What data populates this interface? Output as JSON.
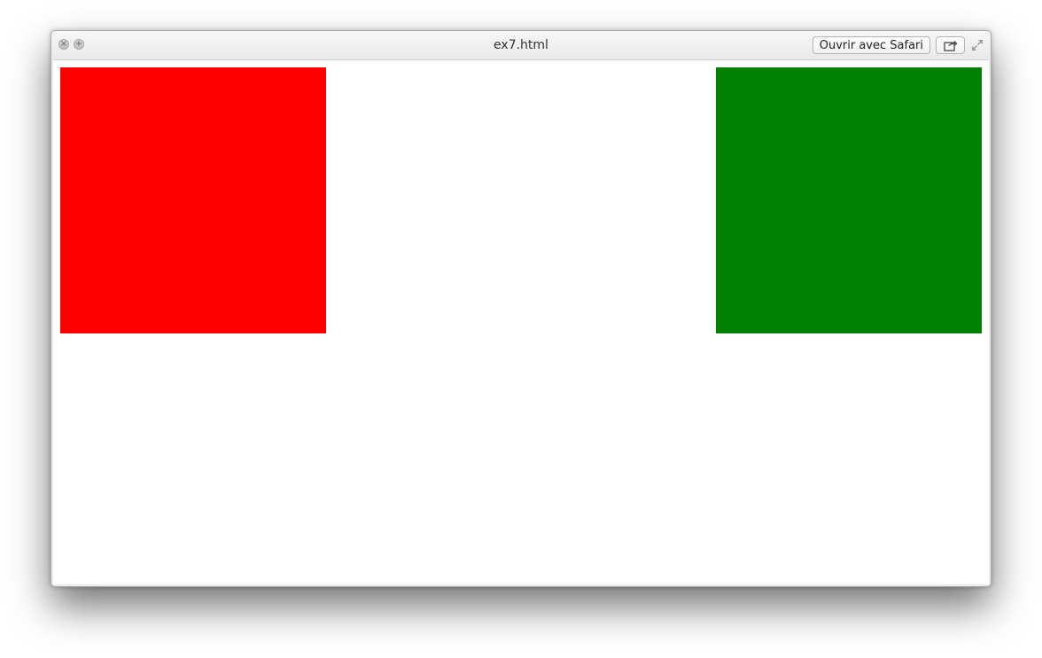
{
  "window": {
    "title": "ex7.html",
    "open_with_label": "Ouvrir avec Safari",
    "icons": {
      "close": "close-icon",
      "zoom": "zoom-icon",
      "share": "share-icon",
      "fullscreen": "fullscreen-icon"
    }
  },
  "content": {
    "boxes": [
      {
        "name": "red-square",
        "color": "#ff0000"
      },
      {
        "name": "green-square",
        "color": "#008000"
      }
    ]
  }
}
